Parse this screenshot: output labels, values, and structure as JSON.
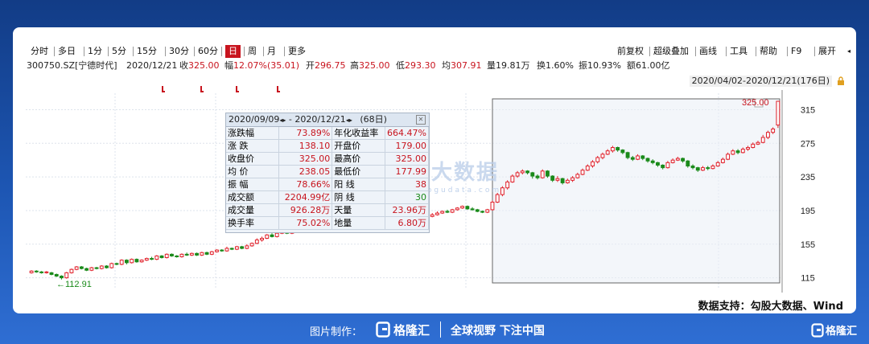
{
  "toolbar": {
    "periods": [
      "分时",
      "多日",
      "1分",
      "5分",
      "15分",
      "30分",
      "60分",
      "日",
      "周",
      "月",
      "更多"
    ],
    "active_period": "日",
    "right_tools": [
      "前复权",
      "超级叠加",
      "画线",
      "工具",
      "帮助",
      "F9",
      "展开"
    ]
  },
  "infobar": {
    "code": "300750.SZ[宁德时代]",
    "date": "2020/12/21",
    "close_label": "收",
    "close": "325.00",
    "change_label": "幅",
    "change": "12.07%(35.01)",
    "open_label": "开",
    "open": "296.75",
    "high_label": "高",
    "high": "325.00",
    "low_label": "低",
    "low": "293.30",
    "avg_label": "均",
    "avg": "307.91",
    "vol_label": "量",
    "vol": "19.81万",
    "turnover_label": "换",
    "turnover": "1.60%",
    "amplitude_label": "振",
    "amplitude": "10.93%",
    "amount_label": "额",
    "amount": "61.00亿"
  },
  "date_range": "2020/04/02-2020/12/21(176日)",
  "stats": {
    "header_start": "2020/09/09",
    "header_sep": " - ",
    "header_end": "2020/12/21",
    "header_days": "(68日)",
    "rows": [
      {
        "l1": "涨跌幅",
        "v1": "73.89%",
        "l2": "年化收益率",
        "v2": "664.47%"
      },
      {
        "l1": "涨  跌",
        "v1": "138.10",
        "l2": "开盘价",
        "v2": "179.00"
      },
      {
        "l1": "收盘价",
        "v1": "325.00",
        "l2": "最高价",
        "v2": "325.00"
      },
      {
        "l1": "均  价",
        "v1": "238.05",
        "l2": "最低价",
        "v2": "177.99"
      },
      {
        "l1": "振  幅",
        "v1": "78.66%",
        "l2": "阳  线",
        "v2": "38"
      },
      {
        "l1": "成交额",
        "v1": "2204.99亿",
        "l2": "阴  线",
        "v2": "30"
      },
      {
        "l1": "成交量",
        "v1": "926.28万",
        "l2": "天量",
        "v2": "23.96万"
      },
      {
        "l1": "换手率",
        "v1": "75.02%",
        "l2": "地量",
        "v2": "6.80万"
      }
    ]
  },
  "watermark": {
    "text": "勾股大数据",
    "sub": "www.gogudata.com"
  },
  "footnote": "数据支持：勾股大数据、Wind",
  "bottom": {
    "made_by": "图片制作：",
    "brand": "格隆汇",
    "slogan": "全球视野 下注中国",
    "corner_brand": "格隆汇"
  },
  "colors": {
    "up": "#e0202a",
    "down": "#1a8a1a",
    "accent": "#c8141e"
  },
  "chart_data": {
    "type": "candlestick",
    "y_ticks": [
      115,
      155,
      195,
      235,
      275,
      315
    ],
    "ylim": [
      107,
      325
    ],
    "min_label": "112.91",
    "max_label": "325.00",
    "series": [
      {
        "o": 121,
        "c": 123,
        "h": 124,
        "l": 120
      },
      {
        "o": 123,
        "c": 122,
        "h": 124,
        "l": 121
      },
      {
        "o": 122,
        "c": 121,
        "h": 123,
        "l": 120
      },
      {
        "o": 121,
        "c": 122,
        "h": 123,
        "l": 120
      },
      {
        "o": 121,
        "c": 119,
        "h": 122,
        "l": 118
      },
      {
        "o": 119,
        "c": 117,
        "h": 120,
        "l": 116
      },
      {
        "o": 117,
        "c": 115,
        "h": 118,
        "l": 113
      },
      {
        "o": 115,
        "c": 121,
        "h": 122,
        "l": 114
      },
      {
        "o": 121,
        "c": 125,
        "h": 126,
        "l": 120
      },
      {
        "o": 125,
        "c": 128,
        "h": 129,
        "l": 124
      },
      {
        "o": 128,
        "c": 126,
        "h": 129,
        "l": 125
      },
      {
        "o": 126,
        "c": 124,
        "h": 127,
        "l": 123
      },
      {
        "o": 124,
        "c": 127,
        "h": 128,
        "l": 123
      },
      {
        "o": 127,
        "c": 126,
        "h": 128,
        "l": 125
      },
      {
        "o": 126,
        "c": 129,
        "h": 130,
        "l": 125
      },
      {
        "o": 129,
        "c": 127,
        "h": 130,
        "l": 126
      },
      {
        "o": 127,
        "c": 132,
        "h": 133,
        "l": 126
      },
      {
        "o": 132,
        "c": 131,
        "h": 133,
        "l": 130
      },
      {
        "o": 131,
        "c": 136,
        "h": 137,
        "l": 130
      },
      {
        "o": 136,
        "c": 133,
        "h": 137,
        "l": 131
      },
      {
        "o": 133,
        "c": 137,
        "h": 138,
        "l": 132
      },
      {
        "o": 137,
        "c": 134,
        "h": 138,
        "l": 133
      },
      {
        "o": 134,
        "c": 136,
        "h": 137,
        "l": 133
      },
      {
        "o": 136,
        "c": 138,
        "h": 139,
        "l": 135
      },
      {
        "o": 138,
        "c": 137,
        "h": 140,
        "l": 136
      },
      {
        "o": 137,
        "c": 141,
        "h": 142,
        "l": 136
      },
      {
        "o": 141,
        "c": 139,
        "h": 142,
        "l": 138
      },
      {
        "o": 139,
        "c": 143,
        "h": 144,
        "l": 138
      },
      {
        "o": 143,
        "c": 141,
        "h": 144,
        "l": 140
      },
      {
        "o": 141,
        "c": 140,
        "h": 142,
        "l": 139
      },
      {
        "o": 140,
        "c": 143,
        "h": 144,
        "l": 139
      },
      {
        "o": 143,
        "c": 142,
        "h": 145,
        "l": 141
      },
      {
        "o": 142,
        "c": 144,
        "h": 145,
        "l": 141
      },
      {
        "o": 144,
        "c": 142,
        "h": 145,
        "l": 141
      },
      {
        "o": 142,
        "c": 145,
        "h": 146,
        "l": 141
      },
      {
        "o": 145,
        "c": 143,
        "h": 146,
        "l": 142
      },
      {
        "o": 143,
        "c": 146,
        "h": 147,
        "l": 142
      },
      {
        "o": 146,
        "c": 148,
        "h": 149,
        "l": 145
      },
      {
        "o": 148,
        "c": 147,
        "h": 149,
        "l": 146
      },
      {
        "o": 147,
        "c": 150,
        "h": 152,
        "l": 146
      },
      {
        "o": 150,
        "c": 149,
        "h": 151,
        "l": 148
      },
      {
        "o": 149,
        "c": 152,
        "h": 153,
        "l": 148
      },
      {
        "o": 152,
        "c": 150,
        "h": 153,
        "l": 149
      },
      {
        "o": 150,
        "c": 153,
        "h": 155,
        "l": 149
      },
      {
        "o": 153,
        "c": 156,
        "h": 157,
        "l": 152
      },
      {
        "o": 156,
        "c": 160,
        "h": 162,
        "l": 155
      },
      {
        "o": 160,
        "c": 162,
        "h": 164,
        "l": 158
      },
      {
        "o": 162,
        "c": 166,
        "h": 167,
        "l": 161
      },
      {
        "o": 166,
        "c": 164,
        "h": 168,
        "l": 163
      },
      {
        "o": 164,
        "c": 168,
        "h": 169,
        "l": 163
      },
      {
        "o": 168,
        "c": 170,
        "h": 171,
        "l": 167
      },
      {
        "o": 170,
        "c": 168,
        "h": 172,
        "l": 167
      },
      {
        "o": 168,
        "c": 171,
        "h": 172,
        "l": 167
      },
      {
        "o": 171,
        "c": 172,
        "h": 174,
        "l": 170
      },
      {
        "o": 172,
        "c": 170,
        "h": 173,
        "l": 169
      },
      {
        "o": 170,
        "c": 172,
        "h": 173,
        "l": 169
      },
      {
        "o": 172,
        "c": 175,
        "h": 177,
        "l": 171
      },
      {
        "o": 175,
        "c": 178,
        "h": 180,
        "l": 174
      },
      {
        "o": 178,
        "c": 180,
        "h": 182,
        "l": 177
      },
      {
        "o": 180,
        "c": 184,
        "h": 186,
        "l": 179
      },
      {
        "o": 184,
        "c": 186,
        "h": 188,
        "l": 183
      },
      {
        "o": 186,
        "c": 185,
        "h": 189,
        "l": 184
      },
      {
        "o": 185,
        "c": 188,
        "h": 190,
        "l": 184
      },
      {
        "o": 188,
        "c": 192,
        "h": 194,
        "l": 187
      },
      {
        "o": 192,
        "c": 196,
        "h": 198,
        "l": 191
      },
      {
        "o": 196,
        "c": 199,
        "h": 201,
        "l": 195
      },
      {
        "o": 199,
        "c": 203,
        "h": 205,
        "l": 198
      },
      {
        "o": 203,
        "c": 206,
        "h": 208,
        "l": 202
      },
      {
        "o": 206,
        "c": 208,
        "h": 210,
        "l": 205
      },
      {
        "o": 208,
        "c": 205,
        "h": 209,
        "l": 203
      },
      {
        "o": 205,
        "c": 209,
        "h": 210,
        "l": 204
      },
      {
        "o": 209,
        "c": 211,
        "h": 213,
        "l": 208
      },
      {
        "o": 211,
        "c": 210,
        "h": 213,
        "l": 209
      },
      {
        "o": 210,
        "c": 212,
        "h": 214,
        "l": 209
      },
      {
        "o": 212,
        "c": 211,
        "h": 213,
        "l": 209
      },
      {
        "o": 211,
        "c": 212,
        "h": 214,
        "l": 210
      },
      {
        "o": 212,
        "c": 196,
        "h": 213,
        "l": 193
      },
      {
        "o": 179,
        "c": 184,
        "h": 186,
        "l": 178
      },
      {
        "o": 184,
        "c": 186,
        "h": 188,
        "l": 183
      },
      {
        "o": 186,
        "c": 188,
        "h": 190,
        "l": 185
      },
      {
        "o": 188,
        "c": 190,
        "h": 192,
        "l": 187
      },
      {
        "o": 190,
        "c": 192,
        "h": 194,
        "l": 189
      },
      {
        "o": 192,
        "c": 194,
        "h": 195,
        "l": 191
      },
      {
        "o": 194,
        "c": 193,
        "h": 196,
        "l": 192
      },
      {
        "o": 193,
        "c": 196,
        "h": 197,
        "l": 192
      },
      {
        "o": 196,
        "c": 198,
        "h": 199,
        "l": 195
      },
      {
        "o": 198,
        "c": 200,
        "h": 201,
        "l": 197
      },
      {
        "o": 200,
        "c": 197,
        "h": 201,
        "l": 196
      },
      {
        "o": 197,
        "c": 196,
        "h": 199,
        "l": 195
      },
      {
        "o": 196,
        "c": 194,
        "h": 197,
        "l": 193
      },
      {
        "o": 194,
        "c": 193,
        "h": 195,
        "l": 192
      },
      {
        "o": 193,
        "c": 196,
        "h": 197,
        "l": 192
      },
      {
        "o": 196,
        "c": 205,
        "h": 207,
        "l": 195
      },
      {
        "o": 205,
        "c": 214,
        "h": 216,
        "l": 204
      },
      {
        "o": 214,
        "c": 222,
        "h": 224,
        "l": 212
      },
      {
        "o": 222,
        "c": 229,
        "h": 231,
        "l": 220
      },
      {
        "o": 229,
        "c": 236,
        "h": 238,
        "l": 228
      },
      {
        "o": 236,
        "c": 240,
        "h": 242,
        "l": 234
      },
      {
        "o": 240,
        "c": 242,
        "h": 244,
        "l": 238
      },
      {
        "o": 242,
        "c": 240,
        "h": 243,
        "l": 238
      },
      {
        "o": 240,
        "c": 236,
        "h": 241,
        "l": 233
      },
      {
        "o": 236,
        "c": 234,
        "h": 238,
        "l": 232
      },
      {
        "o": 234,
        "c": 242,
        "h": 244,
        "l": 233
      },
      {
        "o": 242,
        "c": 236,
        "h": 243,
        "l": 234
      },
      {
        "o": 236,
        "c": 231,
        "h": 237,
        "l": 229
      },
      {
        "o": 231,
        "c": 233,
        "h": 236,
        "l": 229
      },
      {
        "o": 233,
        "c": 228,
        "h": 234,
        "l": 226
      },
      {
        "o": 228,
        "c": 231,
        "h": 233,
        "l": 227
      },
      {
        "o": 231,
        "c": 234,
        "h": 236,
        "l": 229
      },
      {
        "o": 234,
        "c": 238,
        "h": 240,
        "l": 233
      },
      {
        "o": 238,
        "c": 243,
        "h": 245,
        "l": 237
      },
      {
        "o": 243,
        "c": 248,
        "h": 250,
        "l": 242
      },
      {
        "o": 248,
        "c": 253,
        "h": 255,
        "l": 246
      },
      {
        "o": 253,
        "c": 258,
        "h": 260,
        "l": 251
      },
      {
        "o": 258,
        "c": 262,
        "h": 264,
        "l": 256
      },
      {
        "o": 262,
        "c": 266,
        "h": 268,
        "l": 261
      },
      {
        "o": 266,
        "c": 270,
        "h": 272,
        "l": 264
      },
      {
        "o": 270,
        "c": 267,
        "h": 271,
        "l": 265
      },
      {
        "o": 267,
        "c": 264,
        "h": 268,
        "l": 262
      },
      {
        "o": 264,
        "c": 258,
        "h": 265,
        "l": 256
      },
      {
        "o": 258,
        "c": 256,
        "h": 260,
        "l": 254
      },
      {
        "o": 256,
        "c": 260,
        "h": 262,
        "l": 255
      },
      {
        "o": 260,
        "c": 257,
        "h": 261,
        "l": 255
      },
      {
        "o": 257,
        "c": 254,
        "h": 258,
        "l": 252
      },
      {
        "o": 254,
        "c": 252,
        "h": 256,
        "l": 250
      },
      {
        "o": 252,
        "c": 249,
        "h": 253,
        "l": 247
      },
      {
        "o": 249,
        "c": 246,
        "h": 250,
        "l": 244
      },
      {
        "o": 246,
        "c": 252,
        "h": 254,
        "l": 245
      },
      {
        "o": 252,
        "c": 255,
        "h": 257,
        "l": 251
      },
      {
        "o": 255,
        "c": 257,
        "h": 259,
        "l": 254
      },
      {
        "o": 257,
        "c": 254,
        "h": 258,
        "l": 252
      },
      {
        "o": 254,
        "c": 248,
        "h": 255,
        "l": 246
      },
      {
        "o": 248,
        "c": 246,
        "h": 250,
        "l": 244
      },
      {
        "o": 246,
        "c": 243,
        "h": 247,
        "l": 241
      },
      {
        "o": 243,
        "c": 246,
        "h": 248,
        "l": 242
      },
      {
        "o": 246,
        "c": 245,
        "h": 248,
        "l": 243
      },
      {
        "o": 245,
        "c": 248,
        "h": 250,
        "l": 244
      },
      {
        "o": 248,
        "c": 252,
        "h": 254,
        "l": 247
      },
      {
        "o": 252,
        "c": 256,
        "h": 258,
        "l": 251
      },
      {
        "o": 256,
        "c": 262,
        "h": 264,
        "l": 255
      },
      {
        "o": 262,
        "c": 266,
        "h": 268,
        "l": 261
      },
      {
        "o": 266,
        "c": 264,
        "h": 268,
        "l": 262
      },
      {
        "o": 264,
        "c": 268,
        "h": 270,
        "l": 263
      },
      {
        "o": 268,
        "c": 270,
        "h": 272,
        "l": 266
      },
      {
        "o": 270,
        "c": 274,
        "h": 276,
        "l": 269
      },
      {
        "o": 274,
        "c": 276,
        "h": 278,
        "l": 273
      },
      {
        "o": 276,
        "c": 282,
        "h": 285,
        "l": 275
      },
      {
        "o": 282,
        "c": 288,
        "h": 290,
        "l": 280
      },
      {
        "o": 288,
        "c": 292,
        "h": 294,
        "l": 286
      },
      {
        "o": 296.75,
        "c": 325,
        "h": 325,
        "l": 293.3
      }
    ]
  }
}
